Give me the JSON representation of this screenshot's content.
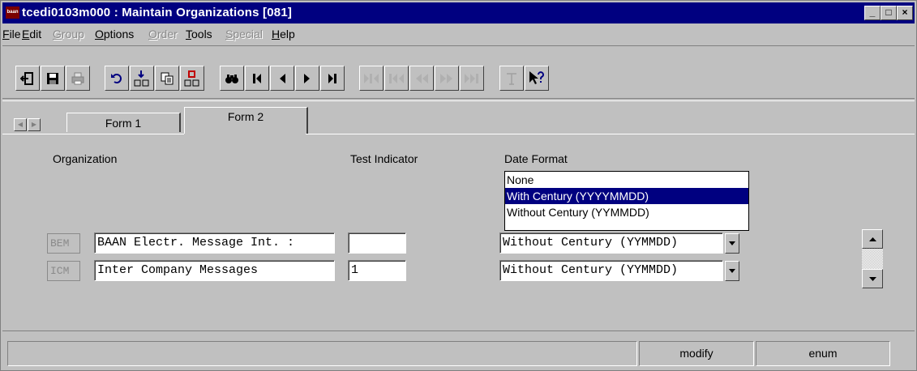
{
  "window": {
    "title": "tcedi0103m000 : Maintain Organizations [081]",
    "app_icon_text": "baan",
    "controls": {
      "minimize": "_",
      "maximize": "□",
      "close": "×"
    }
  },
  "menu": [
    {
      "label": "File",
      "enabled": true
    },
    {
      "label": "Edit",
      "enabled": true
    },
    {
      "label": "Group",
      "enabled": false
    },
    {
      "label": "Options",
      "enabled": true
    },
    {
      "label": "Order",
      "enabled": false
    },
    {
      "label": "Tools",
      "enabled": true
    },
    {
      "label": "Special",
      "enabled": false
    },
    {
      "label": "Help",
      "enabled": true
    }
  ],
  "toolbar": [
    "exit-icon",
    "save-icon",
    "print-icon",
    "undo-icon",
    "insert-record-icon",
    "copy-icon",
    "delete-record-icon",
    "find-icon",
    "first-record-icon",
    "previous-record-icon",
    "next-record-icon",
    "last-record-icon",
    "first-group-icon",
    "previous-group-icon",
    "previous-set-icon",
    "next-set-icon",
    "last-group-icon",
    "text-icon",
    "context-help-icon"
  ],
  "tabs": {
    "form1": "Form 1",
    "form2": "Form 2"
  },
  "columns": {
    "organization": "Organization",
    "test_indicator": "Test Indicator",
    "date_format": "Date Format"
  },
  "rows": [
    {
      "code": "BEM",
      "name": "BAAN Electr. Message Int. :",
      "test": "",
      "date_format": "Without Century (YYMMDD)"
    },
    {
      "code": "ICM",
      "name": "Inter Company Messages",
      "test": "1",
      "date_format": "Without Century (YYMMDD)"
    }
  ],
  "dropdown": {
    "options": [
      "None",
      "With Century (YYYYMMDD)",
      "Without Century (YYMMDD)"
    ],
    "highlighted": "With Century (YYYYMMDD)"
  },
  "status": {
    "message": "",
    "mode": "modify",
    "type": "enum"
  },
  "colors": {
    "title_bar": "#000080",
    "window": "#c0c0c0",
    "highlight": "#000080"
  }
}
